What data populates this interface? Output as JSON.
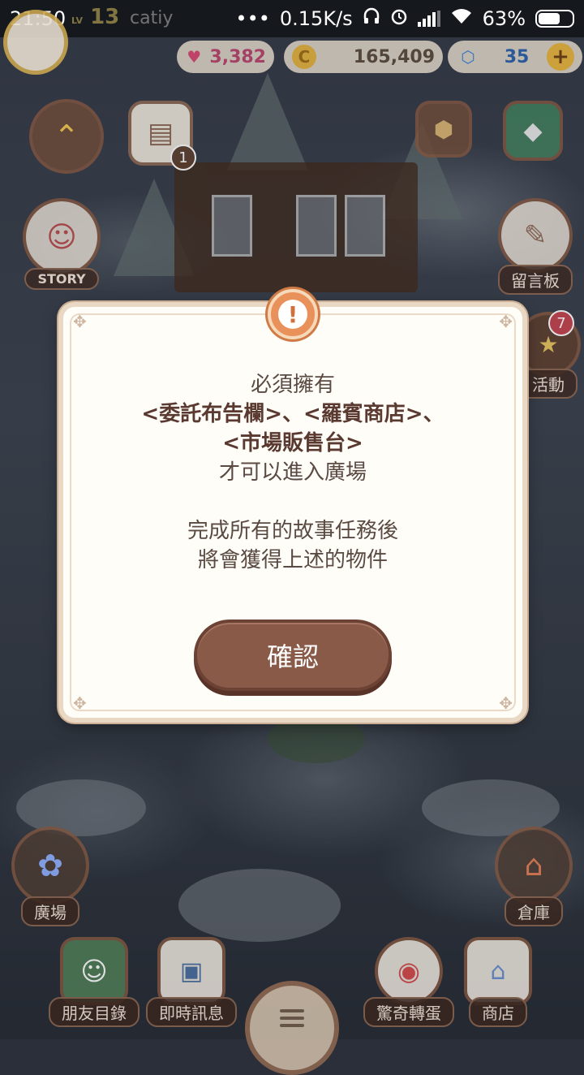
{
  "status_bar": {
    "time": "21:50",
    "dots": "•••",
    "net_speed": "0.15K/s",
    "battery_pct": "63%"
  },
  "hud": {
    "level_prefix": "LV",
    "level": "13",
    "username": "catiy",
    "hearts": "3,382",
    "coins": "165,409",
    "gems": "35",
    "plus": "+"
  },
  "side": {
    "story_label": "STORY",
    "board_label": "留言板",
    "event_label": "活動",
    "event_badge": "7",
    "calendar_badge": "1",
    "plaza_label": "廣場",
    "warehouse_label": "倉庫"
  },
  "bottom": {
    "friends_label": "朋友目錄",
    "messages_label": "即時訊息",
    "gacha_label": "驚奇轉蛋",
    "shop_label": "商店"
  },
  "dialog": {
    "icon": "!",
    "line1": "必須擁有",
    "line2": "<委託布告欄>、<羅賓商店>、",
    "line3": "<市場販售台>",
    "line4": "才可以進入廣場",
    "line5": "完成所有的故事任務後",
    "line6": "將會獲得上述的物件",
    "confirm_label": "確認"
  }
}
